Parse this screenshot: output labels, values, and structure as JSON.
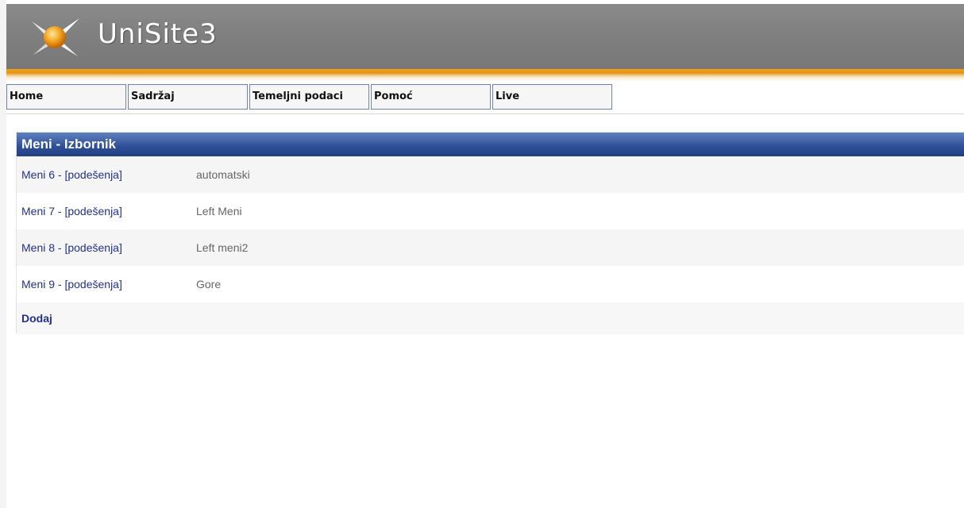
{
  "app": {
    "logo_text": "UniSite3",
    "logo_icon": "unisite-star-logo-icon"
  },
  "nav": {
    "items": [
      {
        "label": "Home"
      },
      {
        "label": "Sadržaj"
      },
      {
        "label": "Temeljni podaci"
      },
      {
        "label": "Pomoć"
      },
      {
        "label": "Live"
      }
    ]
  },
  "panel": {
    "title": "Meni - Izbornik",
    "rows": [
      {
        "link": "Meni 6 - [podešenja]",
        "desc": "automatski"
      },
      {
        "link": "Meni 7 - [podešenja]",
        "desc": "Left Meni"
      },
      {
        "link": "Meni 8 - [podešenja]",
        "desc": "Left meni2"
      },
      {
        "link": "Meni 9 - [podešenja]",
        "desc": "Gore"
      }
    ],
    "add_label": "Dodaj"
  },
  "colors": {
    "header_gray": "#808080",
    "accent_orange": "#e8960f",
    "panel_header_blue": "#2e4f96",
    "link_blue": "#23318a"
  }
}
